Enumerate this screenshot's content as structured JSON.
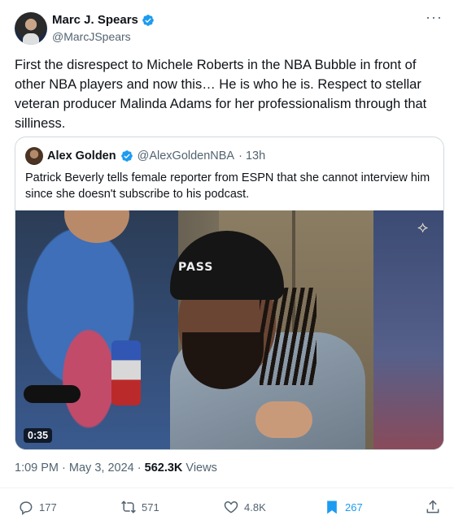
{
  "author": {
    "name": "Marc J. Spears",
    "handle": "@MarcJSpears"
  },
  "more_label": "···",
  "tweet_text": "First the disrespect to Michele Roberts in the NBA Bubble in front of other NBA players and now this… He is who he is. Respect to stellar veteran producer Malinda Adams for her professionalism through that silliness.",
  "quote": {
    "name": "Alex Golden",
    "handle": "@AlexGoldenNBA",
    "time": "· 13h",
    "text": "Patrick Beverly tells female reporter from ESPN that she cannot interview him since she doesn't subscribe to his podcast.",
    "video": {
      "duration": "0:35",
      "hat_text": "PASS"
    }
  },
  "meta": {
    "time": "1:09 PM",
    "sep1": "·",
    "date": "May 3, 2024",
    "sep2": "·",
    "views_count": "562.3K",
    "views_label": "Views"
  },
  "actions": {
    "replies": "177",
    "reposts": "571",
    "likes": "4.8K",
    "bookmarks": "267"
  },
  "colors": {
    "accent": "#1d9bf0",
    "secondary_text": "#536471",
    "border": "#cfd9de"
  },
  "icons": [
    "verified-badge-icon",
    "more-icon",
    "reply-icon",
    "repost-icon",
    "like-icon",
    "bookmark-icon",
    "share-icon",
    "play-overlay-deer-logo-icon"
  ]
}
